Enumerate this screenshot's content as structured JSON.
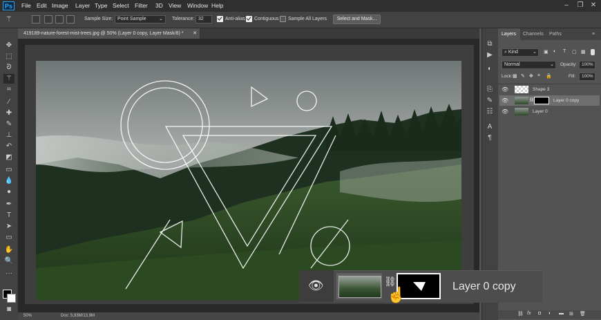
{
  "app": {
    "logo": "Ps"
  },
  "menu": [
    "File",
    "Edit",
    "Image",
    "Layer",
    "Type",
    "Select",
    "Filter",
    "3D",
    "View",
    "Window",
    "Help"
  ],
  "window_controls": [
    "–",
    "❐",
    "✕"
  ],
  "options_bar": {
    "sample_size_label": "Sample Size:",
    "sample_size_value": "Point Sample",
    "tolerance_label": "Tolerance:",
    "tolerance_value": "32",
    "anti_alias_label": "Anti-alias",
    "contiguous_label": "Contiguous",
    "sample_all_layers_label": "Sample All Layers",
    "select_and_mask_label": "Select and Mask..."
  },
  "document": {
    "tab_title": "419189-nature-forest-mist-trees.jpg @ 50% (Layer 0 copy, Layer Mask/8) *",
    "zoom": "50%",
    "doc_info": "Doc: 5,93M/13,9M"
  },
  "layers_panel": {
    "tabs": [
      "Layers",
      "Channels",
      "Paths"
    ],
    "filter_kind": "Kind",
    "blend_mode": "Normal",
    "opacity_label": "Opacity:",
    "opacity_value": "100%",
    "lock_label": "Lock:",
    "fill_label": "Fill:",
    "fill_value": "100%",
    "layers": [
      {
        "name": "Shape 3",
        "visible": true,
        "selected": false
      },
      {
        "name": "Layer 0 copy",
        "visible": true,
        "selected": true
      },
      {
        "name": "Layer 0",
        "visible": true,
        "selected": false
      }
    ],
    "bottom_icons": [
      "link-icon",
      "fx-icon",
      "mask-icon",
      "adjustment-icon",
      "folder-icon",
      "new-layer-icon",
      "trash-icon"
    ]
  },
  "callout": {
    "layer_name": "Layer 0 copy"
  },
  "colors": {
    "accent": "#31a8ff",
    "panel": "#535353",
    "panel_dark": "#424242"
  }
}
